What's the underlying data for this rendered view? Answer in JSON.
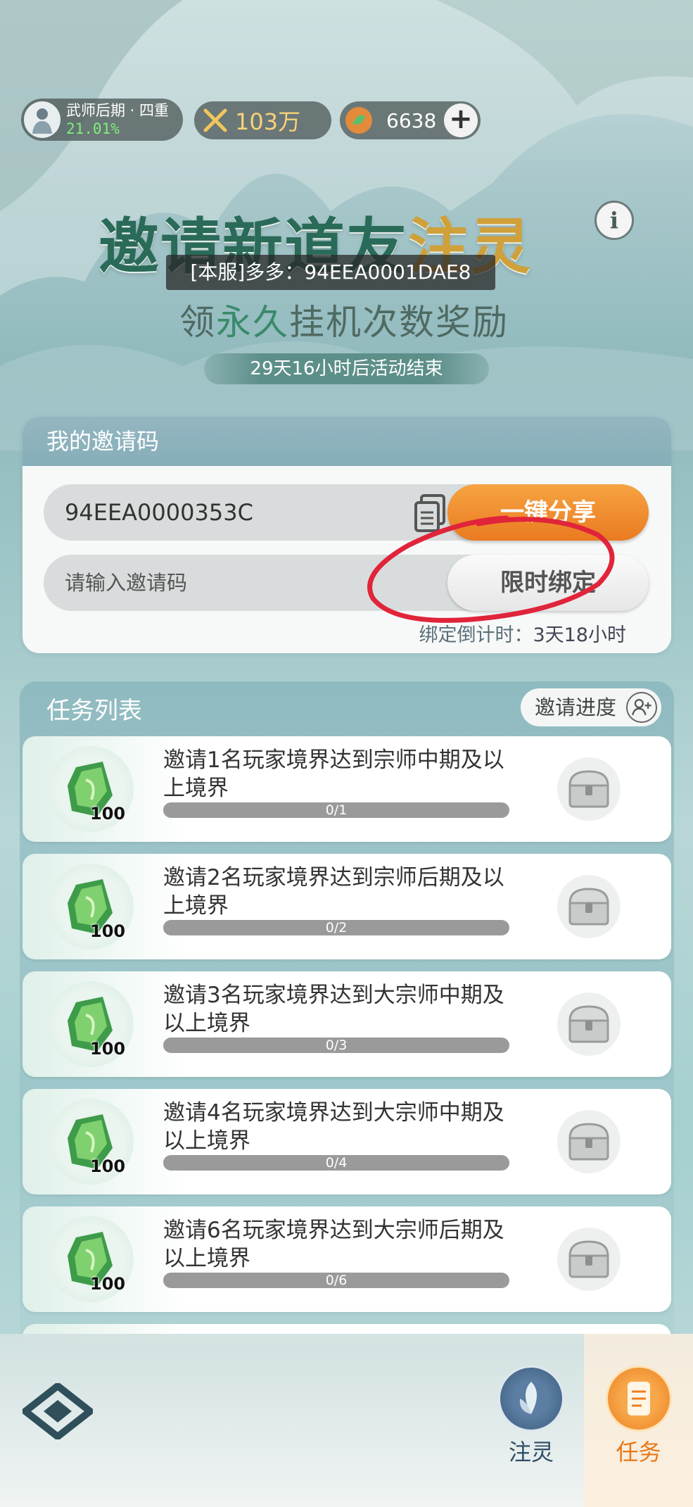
{
  "status": {
    "rank_name": "武师后期 · 四重",
    "rank_progress": "21.01%",
    "combat_power": "103万",
    "currency_amount": "6638",
    "add_label": "+"
  },
  "header": {
    "title_part1": "邀请新道友",
    "title_part2": "注灵",
    "info_label": "i",
    "toast": "[本服]多多：94EEA0001DAE8",
    "subtitle_pre": "领",
    "subtitle_accent": "永久",
    "subtitle_post": "挂机次数奖励",
    "countdown": "29天16小时后活动结束"
  },
  "invite": {
    "section_title": "我的邀请码",
    "my_code": "94EEA0000353C",
    "share_label": "一键分享",
    "input_placeholder": "请输入邀请码",
    "bind_label": "限时绑定",
    "bind_timer_label": "绑定倒计时：",
    "bind_timer_value": "3天18小时"
  },
  "tasks": {
    "section_title": "任务列表",
    "progress_label": "邀请进度",
    "items": [
      {
        "desc": "邀请1名玩家境界达到宗师中期及以上境界",
        "reward": "100",
        "progress": "0/1",
        "fraction": 0
      },
      {
        "desc": "邀请2名玩家境界达到宗师后期及以上境界",
        "reward": "100",
        "progress": "0/2",
        "fraction": 0
      },
      {
        "desc": "邀请3名玩家境界达到大宗师中期及以上境界",
        "reward": "100",
        "progress": "0/3",
        "fraction": 0
      },
      {
        "desc": "邀请4名玩家境界达到大宗师中期及以上境界",
        "reward": "100",
        "progress": "0/4",
        "fraction": 0
      },
      {
        "desc": "邀请6名玩家境界达到大宗师后期及以上境界",
        "reward": "100",
        "progress": "0/6",
        "fraction": 0
      }
    ]
  },
  "nav": {
    "zhuling_label": "注灵",
    "task_label": "任务"
  },
  "colors": {
    "accent_orange": "#ea7a20",
    "title_green": "#2a6a58",
    "title_gold": "#d0a03a",
    "annotation_red": "#e0243a"
  }
}
